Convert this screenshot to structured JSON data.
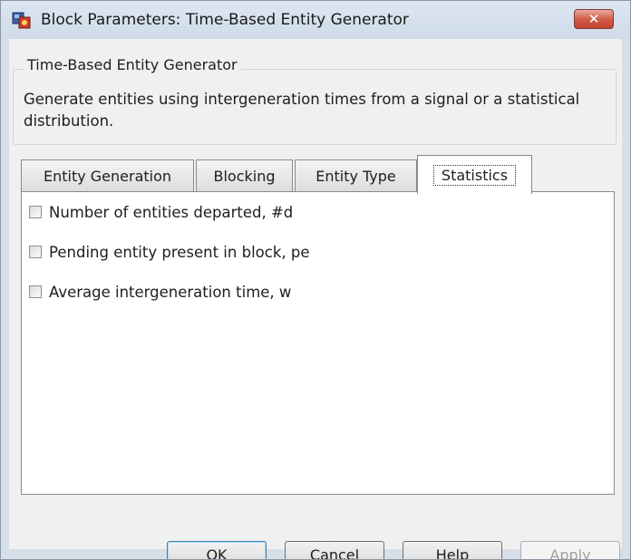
{
  "window": {
    "title": "Block Parameters: Time-Based Entity Generator",
    "icon": "simulink-block-icon",
    "close_symbol": "✕"
  },
  "group": {
    "legend": "Time-Based Entity Generator",
    "description": "Generate entities using intergeneration times from a signal or a statistical distribution."
  },
  "tabs": [
    {
      "label": "Entity Generation",
      "active": false
    },
    {
      "label": "Blocking",
      "active": false
    },
    {
      "label": "Entity Type",
      "active": false
    },
    {
      "label": "Statistics",
      "active": true
    }
  ],
  "statistics": {
    "options": [
      {
        "label": "Number of entities departed, #d",
        "checked": false
      },
      {
        "label": "Pending entity present in block, pe",
        "checked": false
      },
      {
        "label": "Average intergeneration time, w",
        "checked": false
      }
    ]
  },
  "buttons": {
    "ok": "OK",
    "cancel": "Cancel",
    "help": "Help",
    "apply": "Apply",
    "apply_enabled": false
  },
  "colors": {
    "close_button": "#c9503c",
    "title_bar": "#d6e2ee",
    "dialog_bg": "#f0f0f0",
    "default_button_border": "#3c7fb1"
  }
}
